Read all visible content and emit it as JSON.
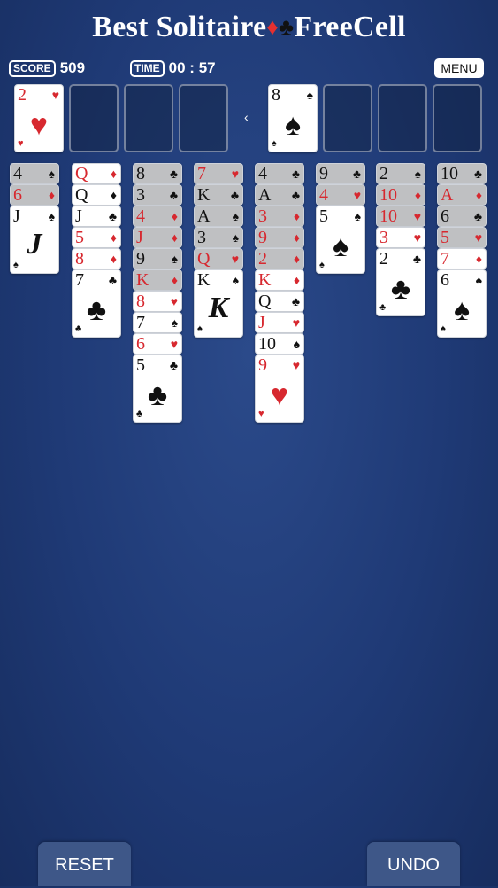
{
  "title": {
    "left": "Best Solitaire",
    "right": "FreeCell"
  },
  "hud": {
    "score_label": "SCORE",
    "score_value": "509",
    "time_label": "TIME",
    "time_value": "00 : 57"
  },
  "menu_label": "MENU",
  "arrow": "‹",
  "free_cells": [
    {
      "rank": "2",
      "suit": "♥",
      "color": "red"
    },
    null,
    null,
    null
  ],
  "foundations": [
    {
      "rank": "8",
      "suit": "♠",
      "color": "black"
    },
    null,
    null,
    null
  ],
  "tableau": [
    [
      {
        "rank": "4",
        "suit": "♠",
        "color": "black",
        "covered": true
      },
      {
        "rank": "6",
        "suit": "♦",
        "color": "red",
        "covered": true
      },
      {
        "rank": "J",
        "suit": "♠",
        "color": "black",
        "covered": false,
        "face": "J"
      }
    ],
    [
      {
        "rank": "Q",
        "suit": "♦",
        "color": "red",
        "covered": false
      },
      {
        "rank": "Q",
        "suit": "♦",
        "color": "black",
        "covered": false
      },
      {
        "rank": "J",
        "suit": "♣",
        "color": "black",
        "covered": false
      },
      {
        "rank": "5",
        "suit": "♦",
        "color": "red",
        "covered": false
      },
      {
        "rank": "8",
        "suit": "♦",
        "color": "red",
        "covered": false
      },
      {
        "rank": "7",
        "suit": "♣",
        "color": "black",
        "covered": false
      }
    ],
    [
      {
        "rank": "8",
        "suit": "♣",
        "color": "black",
        "covered": true
      },
      {
        "rank": "3",
        "suit": "♣",
        "color": "black",
        "covered": true
      },
      {
        "rank": "4",
        "suit": "♦",
        "color": "red",
        "covered": true
      },
      {
        "rank": "J",
        "suit": "♦",
        "color": "red",
        "covered": true
      },
      {
        "rank": "9",
        "suit": "♠",
        "color": "black",
        "covered": true
      },
      {
        "rank": "K",
        "suit": "♦",
        "color": "red",
        "covered": true
      },
      {
        "rank": "8",
        "suit": "♥",
        "color": "red",
        "covered": false
      },
      {
        "rank": "7",
        "suit": "♠",
        "color": "black",
        "covered": false
      },
      {
        "rank": "6",
        "suit": "♥",
        "color": "red",
        "covered": false
      },
      {
        "rank": "5",
        "suit": "♣",
        "color": "black",
        "covered": false
      }
    ],
    [
      {
        "rank": "7",
        "suit": "♥",
        "color": "red",
        "covered": true
      },
      {
        "rank": "K",
        "suit": "♣",
        "color": "black",
        "covered": true
      },
      {
        "rank": "A",
        "suit": "♠",
        "color": "black",
        "covered": true
      },
      {
        "rank": "3",
        "suit": "♠",
        "color": "black",
        "covered": true
      },
      {
        "rank": "Q",
        "suit": "♥",
        "color": "red",
        "covered": true
      },
      {
        "rank": "K",
        "suit": "♠",
        "color": "black",
        "covered": false,
        "face": "K"
      }
    ],
    [
      {
        "rank": "4",
        "suit": "♣",
        "color": "black",
        "covered": true
      },
      {
        "rank": "A",
        "suit": "♣",
        "color": "black",
        "covered": true
      },
      {
        "rank": "3",
        "suit": "♦",
        "color": "red",
        "covered": true
      },
      {
        "rank": "9",
        "suit": "♦",
        "color": "red",
        "covered": true
      },
      {
        "rank": "2",
        "suit": "♦",
        "color": "red",
        "covered": true
      },
      {
        "rank": "K",
        "suit": "♦",
        "color": "red",
        "covered": false
      },
      {
        "rank": "Q",
        "suit": "♣",
        "color": "black",
        "covered": false
      },
      {
        "rank": "J",
        "suit": "♥",
        "color": "red",
        "covered": false
      },
      {
        "rank": "10",
        "suit": "♠",
        "color": "black",
        "covered": false
      },
      {
        "rank": "9",
        "suit": "♥",
        "color": "red",
        "covered": false
      }
    ],
    [
      {
        "rank": "9",
        "suit": "♣",
        "color": "black",
        "covered": true
      },
      {
        "rank": "4",
        "suit": "♥",
        "color": "red",
        "covered": true
      },
      {
        "rank": "5",
        "suit": "♠",
        "color": "black",
        "covered": false
      }
    ],
    [
      {
        "rank": "2",
        "suit": "♠",
        "color": "black",
        "covered": true
      },
      {
        "rank": "10",
        "suit": "♦",
        "color": "red",
        "covered": true
      },
      {
        "rank": "10",
        "suit": "♥",
        "color": "red",
        "covered": true
      },
      {
        "rank": "3",
        "suit": "♥",
        "color": "red",
        "covered": false
      },
      {
        "rank": "2",
        "suit": "♣",
        "color": "black",
        "covered": false
      }
    ],
    [
      {
        "rank": "10",
        "suit": "♣",
        "color": "black",
        "covered": true
      },
      {
        "rank": "A",
        "suit": "♦",
        "color": "red",
        "covered": true
      },
      {
        "rank": "6",
        "suit": "♣",
        "color": "black",
        "covered": true
      },
      {
        "rank": "5",
        "suit": "♥",
        "color": "red",
        "covered": true
      },
      {
        "rank": "7",
        "suit": "♦",
        "color": "red",
        "covered": false
      },
      {
        "rank": "6",
        "suit": "♠",
        "color": "black",
        "covered": false
      }
    ]
  ],
  "buttons": {
    "reset": "RESET",
    "undo": "UNDO"
  }
}
